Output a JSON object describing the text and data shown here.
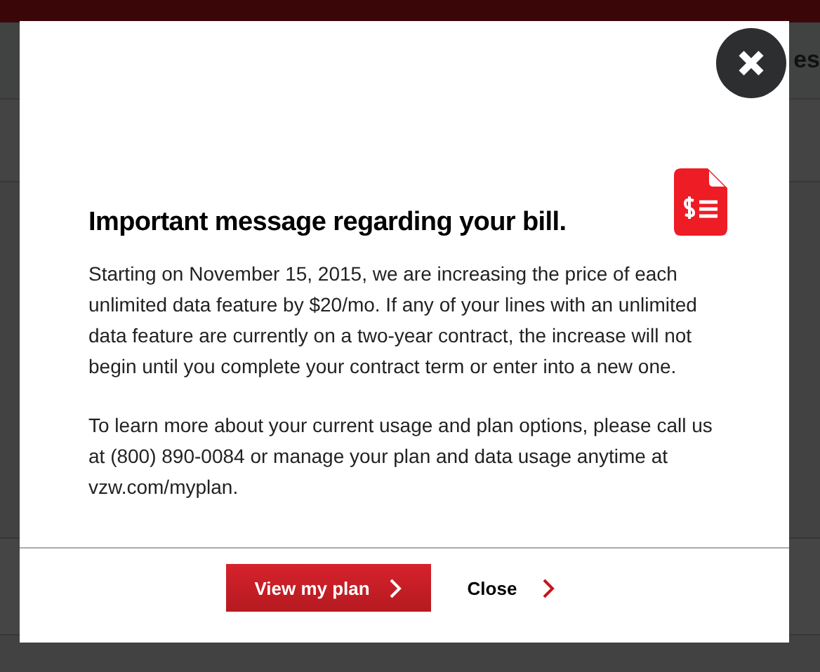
{
  "background": {
    "nav_fragment": "es"
  },
  "modal": {
    "title": "Important message regarding your bill.",
    "paragraphs": [
      "Starting on November 15, 2015, we are increasing the price of each unlimited data feature by $20/mo. If any of your lines with an unlimited data feature are currently on a two-year contract, the increase will not begin until you complete your contract term or enter into a new one.",
      "To learn more about your current usage and plan options, please call us at (800) 890-0084 or manage your plan and data usage anytime at vzw.com/myplan."
    ],
    "buttons": [
      {
        "label": "View my plan",
        "kind": "primary"
      },
      {
        "label": "Close",
        "kind": "link"
      }
    ]
  }
}
